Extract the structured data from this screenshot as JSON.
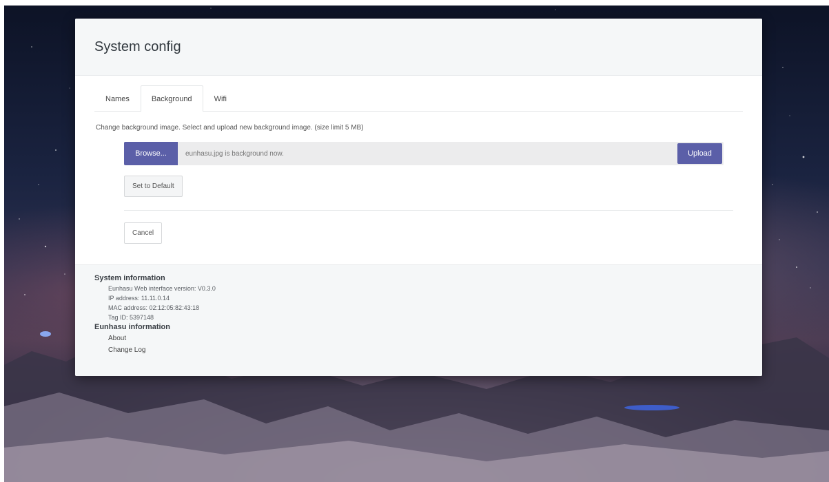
{
  "modal": {
    "title": "System config",
    "tabs": [
      {
        "label": "Names",
        "active": false
      },
      {
        "label": "Background",
        "active": true
      },
      {
        "label": "Wifi",
        "active": false
      }
    ],
    "help_text": "Change background image. Select and upload new background image. (size limit 5 MB)",
    "browse_label": "Browse...",
    "file_placeholder": "eunhasu.jpg is background now.",
    "upload_label": "Upload",
    "default_label": "Set to Default",
    "cancel_label": "Cancel"
  },
  "footer": {
    "system_heading": "System information",
    "system_lines": [
      "Eunhasu Web interface version: V0.3.0",
      "IP address: 11.11.0.14",
      "MAC address: 02:12:05:82:43:18",
      "Tag ID: 5397148"
    ],
    "eunhasu_heading": "Eunhasu information",
    "links": [
      "About",
      "Change Log"
    ]
  },
  "colors": {
    "primary": "#5b5fa8",
    "header_bg": "#f5f7f8"
  }
}
